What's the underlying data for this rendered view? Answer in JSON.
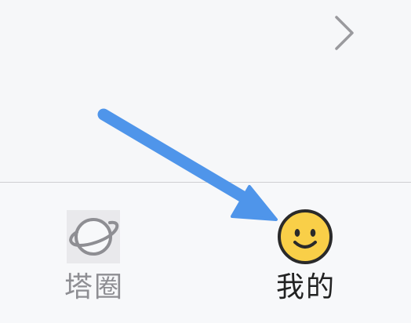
{
  "tabs": [
    {
      "label": "塔圈",
      "icon": "planet-icon",
      "selected": false
    },
    {
      "label": "我的",
      "icon": "smiley-face-icon",
      "selected": true
    }
  ],
  "colors": {
    "arrow": "#4f95ea",
    "smiley_fill": "#f9cf48",
    "inactive_label": "#8e8e93",
    "active_label": "#222222"
  }
}
